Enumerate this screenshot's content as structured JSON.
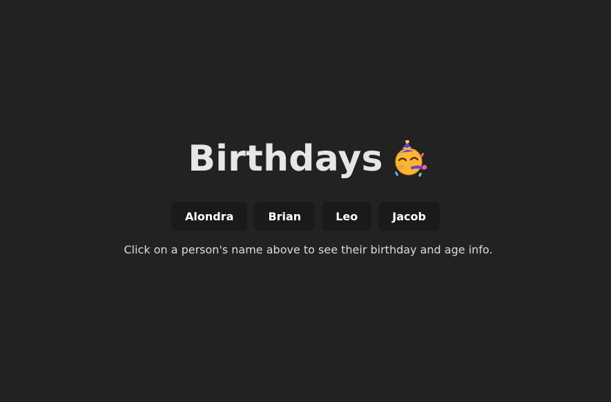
{
  "header": {
    "title": "Birthdays",
    "icon": "partying-face-icon"
  },
  "people": [
    {
      "label": "Alondra"
    },
    {
      "label": "Brian"
    },
    {
      "label": "Leo"
    },
    {
      "label": "Jacob"
    }
  ],
  "hint_text": "Click on a person's name above to see their birthday and age info.",
  "colors": {
    "background": "#222222",
    "button_background": "#1a1a1a",
    "text": "#e6e6e6"
  }
}
